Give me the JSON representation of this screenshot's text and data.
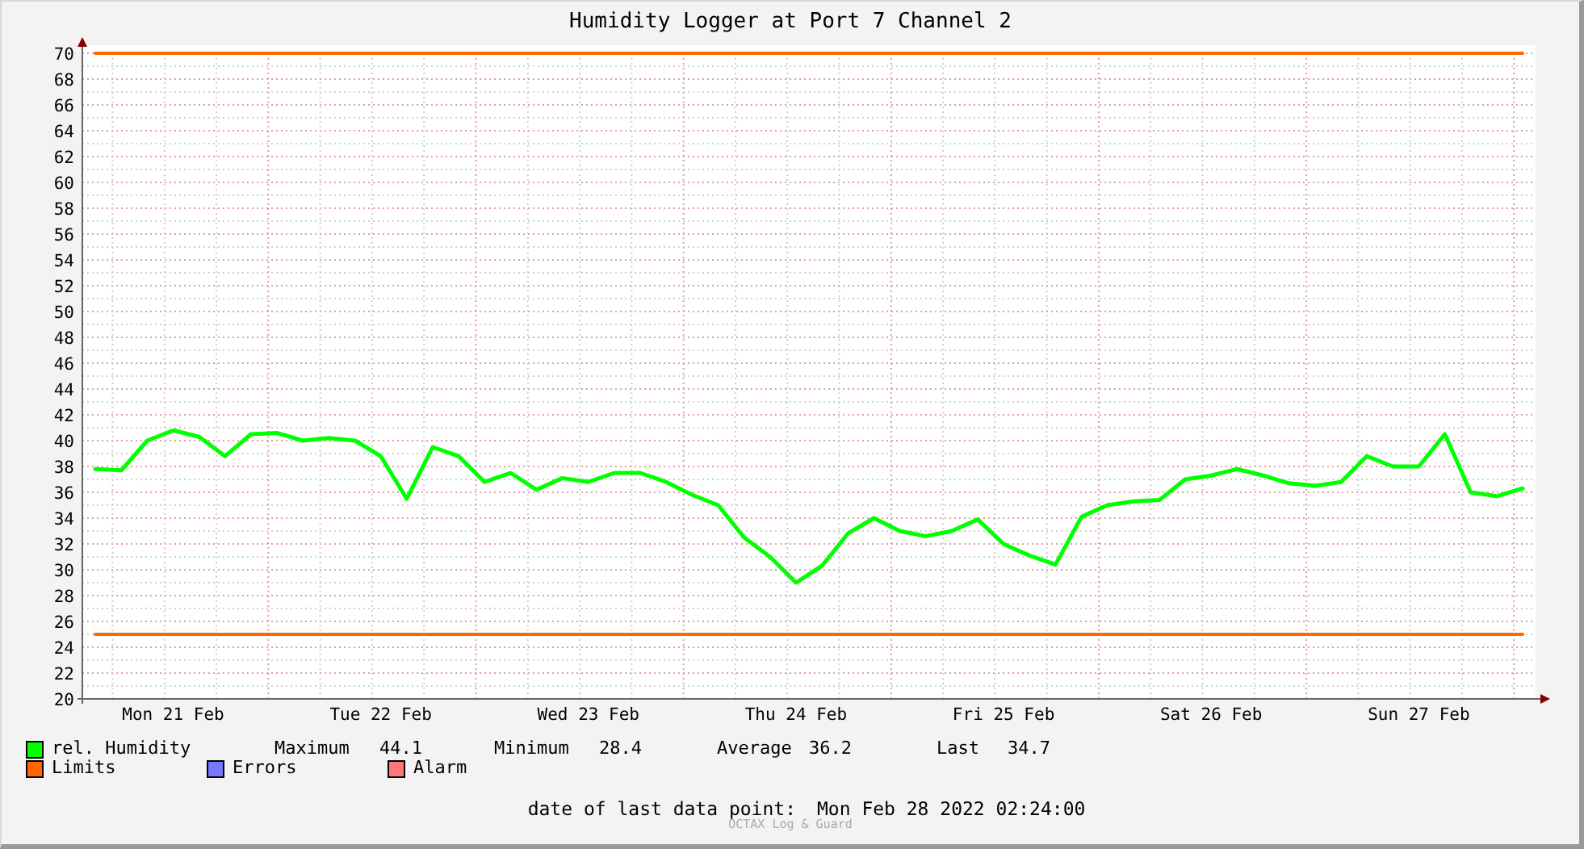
{
  "title": "Humidity Logger at Port 7 Channel 2",
  "chart_data": {
    "type": "line",
    "ylim": [
      20,
      70
    ],
    "yticks": [
      20,
      22,
      24,
      26,
      28,
      30,
      32,
      34,
      36,
      38,
      40,
      42,
      44,
      46,
      48,
      50,
      52,
      54,
      56,
      58,
      60,
      62,
      64,
      66,
      68,
      70
    ],
    "categories": [
      null,
      null,
      null,
      "Mon 21 Feb",
      null,
      null,
      null,
      null,
      null,
      null,
      null,
      "Tue 22 Feb",
      null,
      null,
      null,
      null,
      null,
      null,
      null,
      "Wed 23 Feb",
      null,
      null,
      null,
      null,
      null,
      null,
      null,
      "Thu 24 Feb",
      null,
      null,
      null,
      null,
      null,
      null,
      null,
      "Fri 25 Feb",
      null,
      null,
      null,
      null,
      null,
      null,
      null,
      "Sat 26 Feb",
      null,
      null,
      null,
      null,
      null,
      null,
      null,
      "Sun 27 Feb",
      null,
      null,
      null,
      null
    ],
    "series": [
      {
        "name": "rel. Humidity",
        "color": "#00ff00",
        "values": [
          37.8,
          37.7,
          40,
          40.8,
          40.3,
          38.8,
          40.5,
          40.6,
          40,
          40.2,
          40,
          38.8,
          35.5,
          39.5,
          38.8,
          36.8,
          37.5,
          36.2,
          37.1,
          36.8,
          37.5,
          37.5,
          36.8,
          35.8,
          35,
          32.5,
          31,
          29,
          30.3,
          32.8,
          34,
          33,
          32.6,
          33,
          33.9,
          32,
          31.1,
          30.4,
          34.1,
          35,
          35.3,
          35.4,
          37,
          37.3,
          37.8,
          37.3,
          36.7,
          36.5,
          36.8,
          38.8,
          38,
          38,
          40.5,
          36,
          35.7,
          36.3
        ]
      },
      {
        "name": "Limits",
        "color": "#ff6600",
        "values": [
          70,
          70,
          70,
          70,
          70,
          70,
          70,
          70,
          70,
          70,
          70,
          70,
          70,
          70,
          70,
          70,
          70,
          70,
          70,
          70,
          70,
          70,
          70,
          70,
          70,
          70,
          70,
          70,
          70,
          70,
          70,
          70,
          70,
          70,
          70,
          70,
          70,
          70,
          70,
          70,
          70,
          70,
          70,
          70,
          70,
          70,
          70,
          70,
          70,
          70,
          70,
          70,
          70,
          70,
          70,
          70
        ]
      },
      {
        "color": "#ff6600",
        "values": [
          25,
          25,
          25,
          25,
          25,
          25,
          25,
          25,
          25,
          25,
          25,
          25,
          25,
          25,
          25,
          25,
          25,
          25,
          25,
          25,
          25,
          25,
          25,
          25,
          25,
          25,
          25,
          25,
          25,
          25,
          25,
          25,
          25,
          25,
          25,
          25,
          25,
          25,
          25,
          25,
          25,
          25,
          25,
          25,
          25,
          25,
          25,
          25,
          25,
          25,
          25,
          25,
          25,
          25,
          25,
          25
        ]
      }
    ],
    "grid": true
  },
  "legend": [
    {
      "label": "Errors",
      "color": "#7777ff"
    },
    {
      "label": "Alarm",
      "color": "#ff7777"
    }
  ],
  "stats": [
    {
      "label": "Maximum",
      "value": "44.1"
    },
    {
      "label": "Minimum",
      "value": "28.4"
    },
    {
      "label": "Average",
      "value": "36.2"
    },
    {
      "label": "Last",
      "value": "34.7"
    }
  ],
  "last_data_point": {
    "label": "date of last data point:",
    "value": "Mon Feb 28 2022 02:24:00"
  },
  "credit": "OCTAX Log & Guard"
}
